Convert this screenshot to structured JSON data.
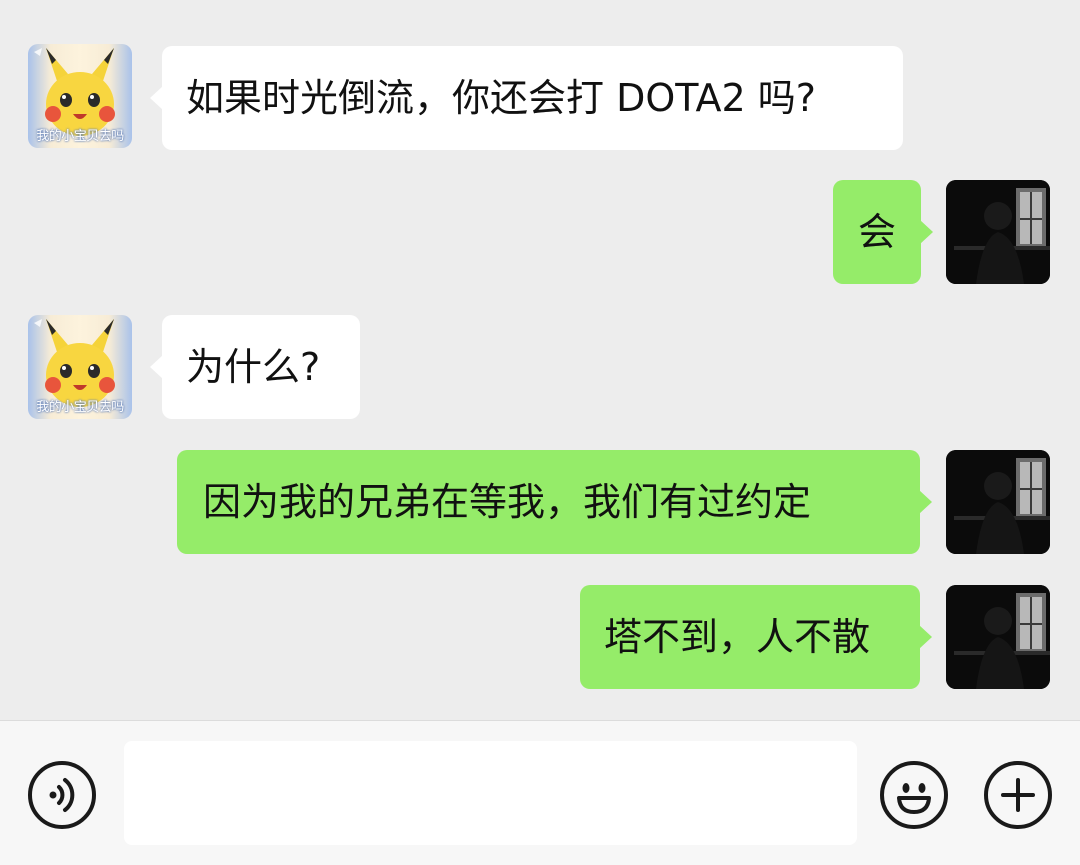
{
  "chat": {
    "messages": [
      {
        "direction": "incoming",
        "text": "如果时光倒流，你还会打 DOTA2 吗?",
        "avatar": "pikachu-avatar",
        "avatar_caption": "我的小宝贝去吗"
      },
      {
        "direction": "outgoing",
        "text": "会",
        "avatar": "silhouette-avatar"
      },
      {
        "direction": "incoming",
        "text": "为什么?",
        "avatar": "pikachu-avatar",
        "avatar_caption": "我的小宝贝去吗"
      },
      {
        "direction": "outgoing",
        "text": "因为我的兄弟在等我，我们有过约定",
        "avatar": "silhouette-avatar"
      },
      {
        "direction": "outgoing",
        "text": "塔不到，人不散",
        "avatar": "silhouette-avatar"
      }
    ]
  },
  "toolbar": {
    "voice_icon": "voice-icon",
    "input_value": "",
    "emoji_icon": "emoji-icon",
    "plus_icon": "plus-icon"
  },
  "colors": {
    "background": "#ededed",
    "incoming_bubble": "#ffffff",
    "outgoing_bubble": "#95ec69",
    "toolbar": "#f7f7f7"
  }
}
